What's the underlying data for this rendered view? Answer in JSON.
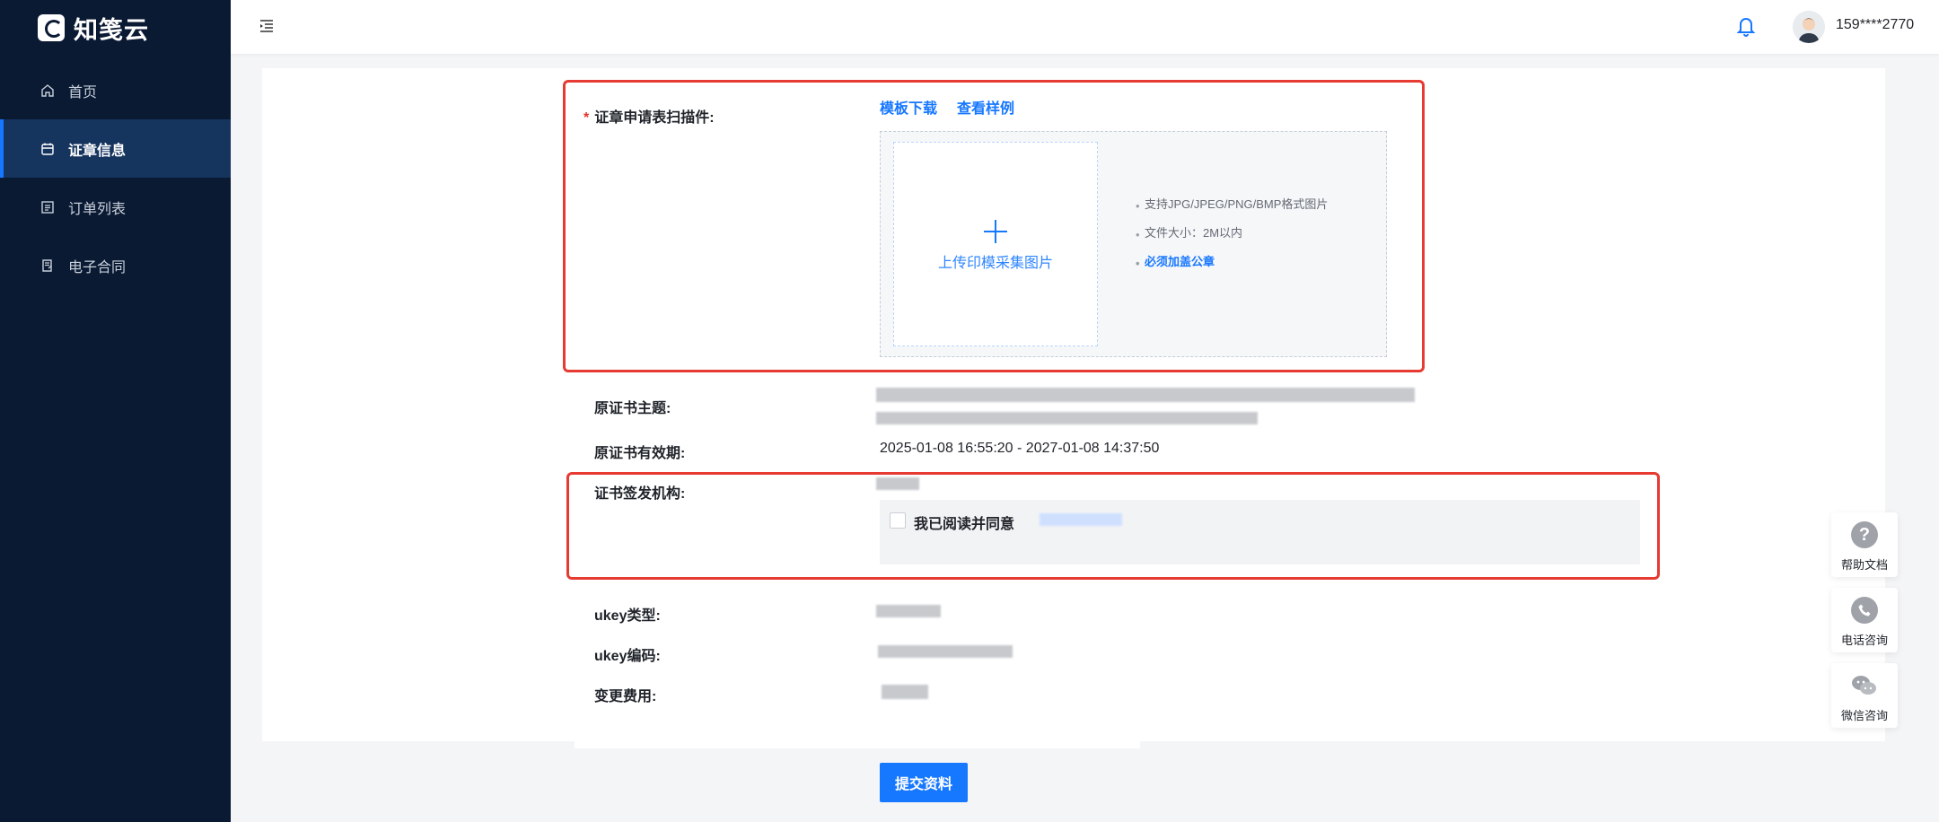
{
  "app": {
    "logo_text": "知笺云"
  },
  "sidebar": {
    "items": [
      {
        "label": "首页",
        "icon": "home-icon"
      },
      {
        "label": "证章信息",
        "icon": "calendar-icon",
        "active": true
      },
      {
        "label": "订单列表",
        "icon": "list-icon"
      },
      {
        "label": "电子合同",
        "icon": "contract-icon"
      }
    ]
  },
  "header": {
    "username": "159****2770",
    "icons": [
      "menu-fold-icon",
      "bell-icon",
      "avatar"
    ]
  },
  "form": {
    "scan_label": "证章申请表扫描件:",
    "template_download": "模板下载",
    "view_sample": "查看样例",
    "upload_text": "上传印模采集图片",
    "tips": [
      "支持JPG/JPEG/PNG/BMP格式图片",
      "文件大小：2M以内",
      "必须加盖公章"
    ],
    "cert_subject_label": "原证书主题:",
    "cert_validity_label": "原证书有效期:",
    "cert_validity_value": "2025-01-08 16:55:20 - 2027-01-08 14:37:50",
    "issuer_label": "证书签发机构:",
    "agree_text": "我已阅读并同意",
    "ukey_type_label": "ukey类型:",
    "ukey_code_label": "ukey编码:",
    "fee_label": "变更费用:",
    "submit": "提交资料"
  },
  "float_panel": [
    {
      "label": "帮助文档",
      "icon": "help-icon"
    },
    {
      "label": "电话咨询",
      "icon": "phone-icon"
    },
    {
      "label": "微信咨询",
      "icon": "wechat-icon"
    }
  ],
  "colors": {
    "sidebar_bg": "#0b1a33",
    "active_bg": "#15345e",
    "primary": "#1677ff",
    "highlight": "#e63a32"
  }
}
